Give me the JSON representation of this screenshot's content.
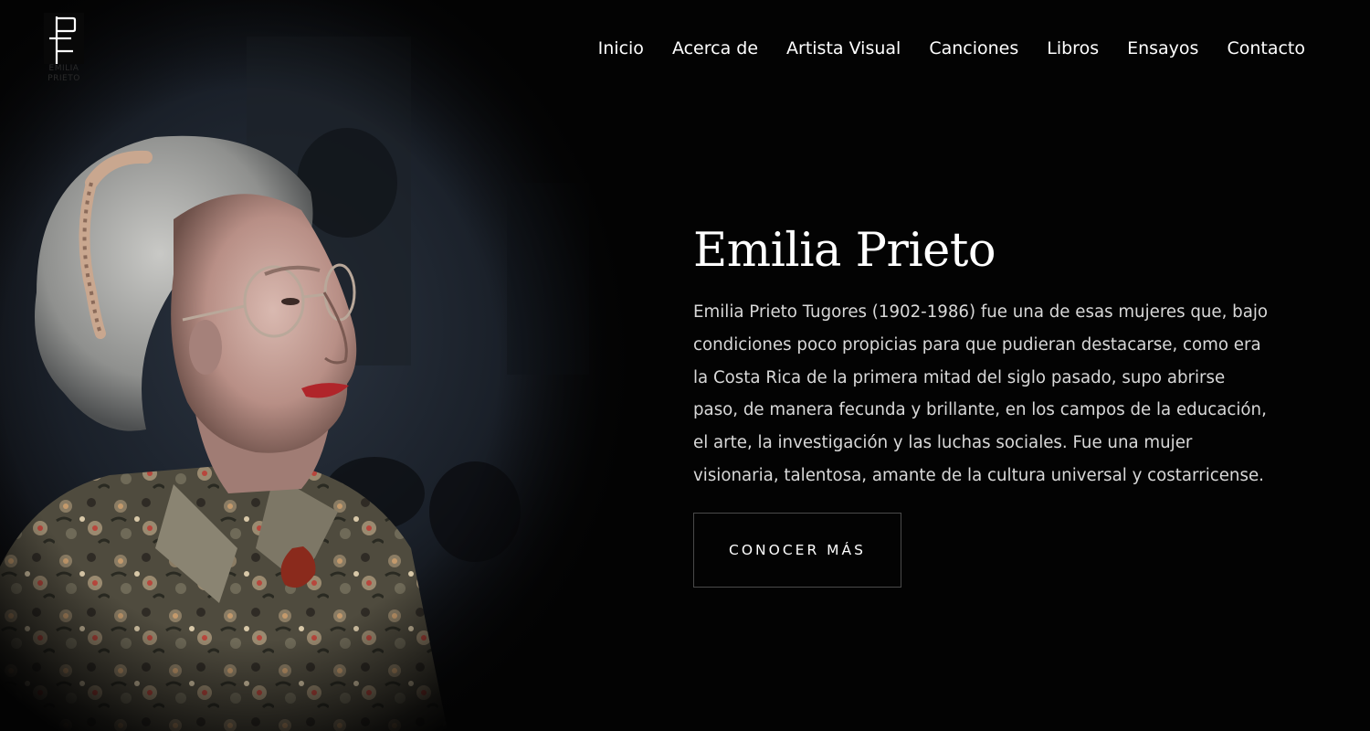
{
  "logo": {
    "caption": "EMILIA\nPRIETO"
  },
  "nav": {
    "items": [
      "Inicio",
      "Acerca de",
      "Artista Visual",
      "Canciones",
      "Libros",
      "Ensayos",
      "Contacto"
    ]
  },
  "hero": {
    "title": "Emilia Prieto",
    "body": "Emilia Prieto Tugores (1902-1986) fue una de esas mujeres que, bajo\ncondiciones poco propicias para que pudieran destacarse, como era\nla Costa Rica de la primera mitad del siglo pasado, supo abrirse\npaso, de manera fecunda y brillante, en los campos de la educación,\nel arte, la investigación y las luchas sociales. Fue una mujer\nvisionaria, talentosa, amante de la cultura universal y costarricense.",
    "cta_label": "CONOCER MÁS"
  }
}
